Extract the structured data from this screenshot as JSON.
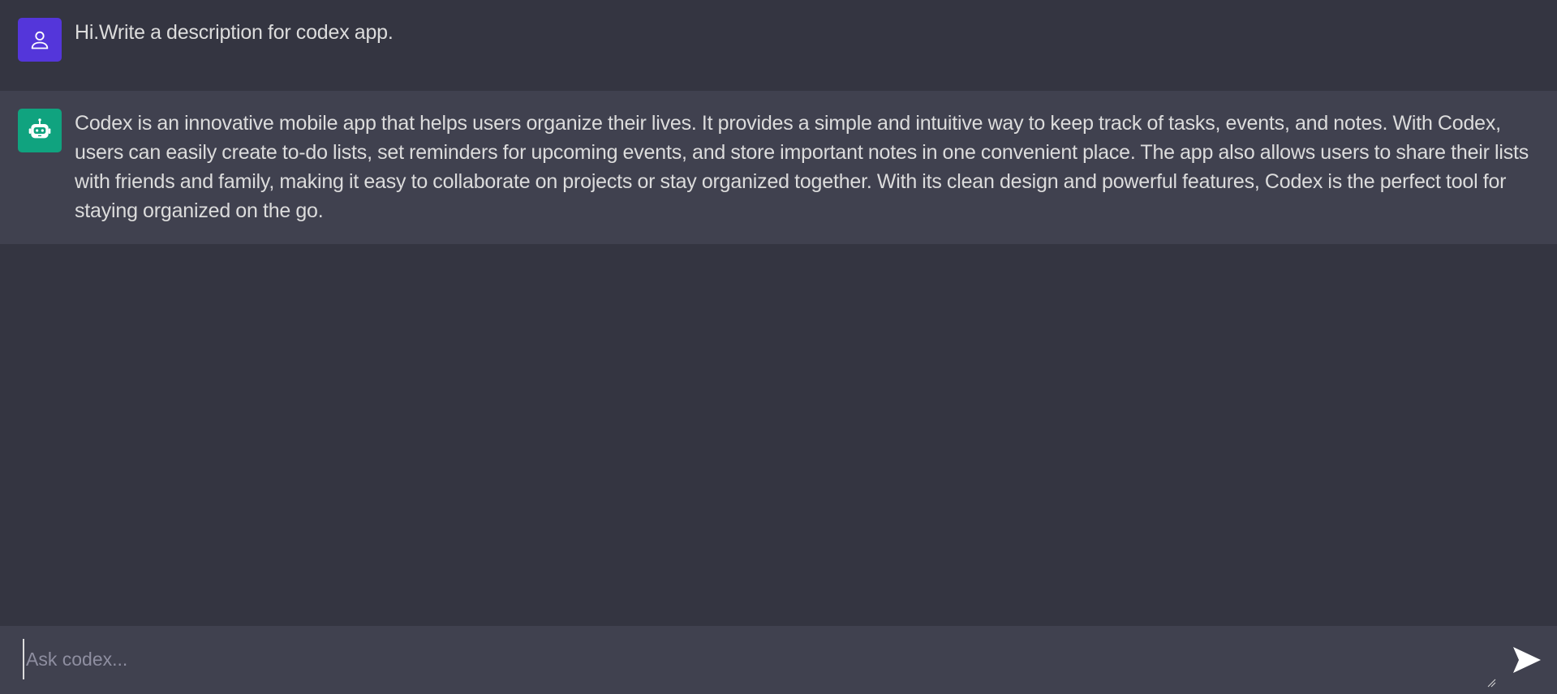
{
  "conversation": {
    "messages": [
      {
        "role": "user",
        "avatar_icon": "user-icon",
        "avatar_color": "#5436da",
        "text": "Hi.Write a description for codex app."
      },
      {
        "role": "assistant",
        "avatar_icon": "bot-icon",
        "avatar_color": "#10a37f",
        "text": "Codex is an innovative mobile app that helps users organize their lives. It provides a simple and intuitive way to keep track of tasks, events, and notes. With Codex, users can easily create to-do lists, set reminders for upcoming events, and store important notes in one convenient place. The app also allows users to share their lists with friends and family, making it easy to collaborate on projects or stay organized together. With its clean design and powerful features, Codex is the perfect tool for staying organized on the go."
      }
    ]
  },
  "composer": {
    "placeholder": "Ask codex...",
    "value": "",
    "send_icon": "send-icon"
  },
  "colors": {
    "background": "#343541",
    "assistant_row": "#40414f",
    "composer": "#40414f",
    "text": "#dcdcdc"
  }
}
